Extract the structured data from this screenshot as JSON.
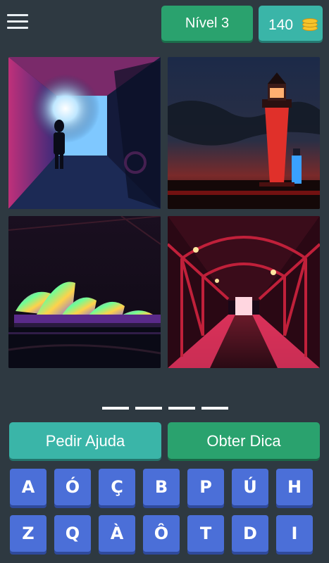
{
  "header": {
    "menu_icon": "hamburger-menu-icon",
    "level_label": "Nível 3",
    "coins": "140",
    "coin_icon": "coin-stack-icon"
  },
  "photos": [
    {
      "name": "photo-tunnel",
      "subject": "neon-lit tunnel with silhouette"
    },
    {
      "name": "photo-lighthouse",
      "subject": "illuminated lighthouse at dusk"
    },
    {
      "name": "photo-opera-house",
      "subject": "colorfully lit opera house at night"
    },
    {
      "name": "photo-bridge",
      "subject": "red-lit steel truss bridge"
    }
  ],
  "answer": {
    "slot_count": 4
  },
  "actions": {
    "help_label": "Pedir Ajuda",
    "hint_label": "Obter Dica"
  },
  "keyboard": {
    "row1": [
      "A",
      "Ó",
      "Ç",
      "B",
      "P",
      "Ú",
      "H"
    ],
    "row2": [
      "Z",
      "Q",
      "À",
      "Ô",
      "T",
      "D",
      "I"
    ]
  },
  "colors": {
    "background": "#2e3941",
    "level_green": "#2aa26e",
    "teal": "#3ab5a8",
    "key_blue": "#4b6fd8"
  }
}
